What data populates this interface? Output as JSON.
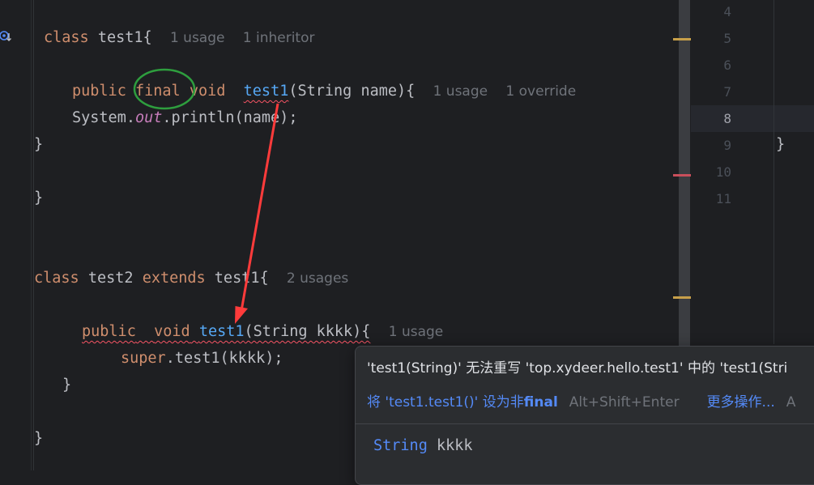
{
  "editor": {
    "lines": {
      "class1": {
        "kw": "class",
        "name": "test1{",
        "hint_usage": "1 usage",
        "hint_inheritor": "1 inheritor"
      },
      "method1": {
        "kw_public": "public",
        "kw_final": "final",
        "kw_void": "void",
        "fn": "test1",
        "params": "(String name){",
        "hint_usage": "1 usage",
        "hint_override": "1 override"
      },
      "println": {
        "obj": "System.",
        "field": "out",
        "rest": ".println(name);"
      },
      "close1": "}",
      "close2": "}",
      "class2": {
        "kw": "class",
        "name": "test2",
        "kw_extends": "extends",
        "parent": "test1{",
        "hint_usages": "2 usages"
      },
      "method2": {
        "kw_public": "public",
        "kw_void": "void",
        "fn": "test1",
        "params": "(String kkkk){",
        "hint_usage": "1 usage"
      },
      "super": {
        "kw": "super",
        "rest": ".test1(kkkk);"
      },
      "close3": "}",
      "close4": "}"
    }
  },
  "line_numbers": [
    "4",
    "5",
    "6",
    "7",
    "8",
    "9",
    "10",
    "11"
  ],
  "minimap": {
    "brace": "}"
  },
  "popup": {
    "message": "'test1(String)' 无法重写 'top.xydeer.hello.test1' 中的 'test1(Stri",
    "action": {
      "prefix": "将 ",
      "target": "'test1.test1()'",
      "middle": " 设为非",
      "bold": "final",
      "shortcut": "Alt+Shift+Enter",
      "more": "更多操作...",
      "more_shortcut": "A"
    },
    "signature": {
      "type": "String",
      "name": " kkkk"
    }
  },
  "colors": {
    "background": "#1e1f22",
    "keyword": "#cf8e6d",
    "function": "#56a8f5",
    "error": "#f75464",
    "annotation_red": "#ff3b3b",
    "annotation_green": "#2e9e3e",
    "warning_mark": "#c8a04a"
  }
}
